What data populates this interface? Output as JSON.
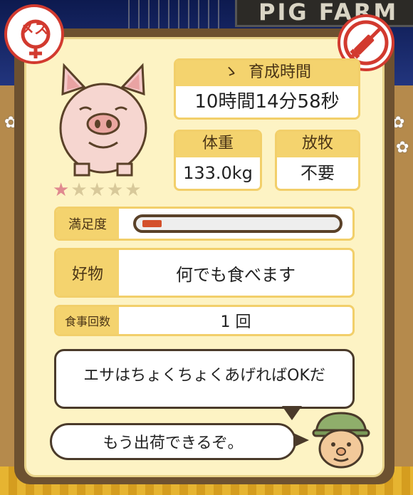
{
  "background": {
    "sign_text": "PIG FARM"
  },
  "badges": {
    "gender_label": "メス",
    "gender_icon": "female-icon",
    "medicine_icon": "no-medicine-icon"
  },
  "pig": {
    "stars_filled": 1,
    "stars_total": 5
  },
  "stats": {
    "time_label": "育成時間",
    "time_value": "10時間14分58秒",
    "weight_label": "体重",
    "weight_value": "133.0kg",
    "graze_label": "放牧",
    "graze_value": "不要"
  },
  "rows": {
    "satisfaction_label": "満足度",
    "satisfaction_level": 0.1,
    "favorite_label": "好物",
    "favorite_value": "何でも食べます",
    "meal_label": "食事回数",
    "meal_value": "1 回"
  },
  "dialog": {
    "line1": "エサはちょくちょくあげればOKだ",
    "line2": "もう出荷できるぞ。"
  },
  "colors": {
    "accent_red": "#d23a2f",
    "panel_bg": "#fdf3c4",
    "label_bg": "#f4d36e",
    "bar_fill": "#d4502c"
  }
}
